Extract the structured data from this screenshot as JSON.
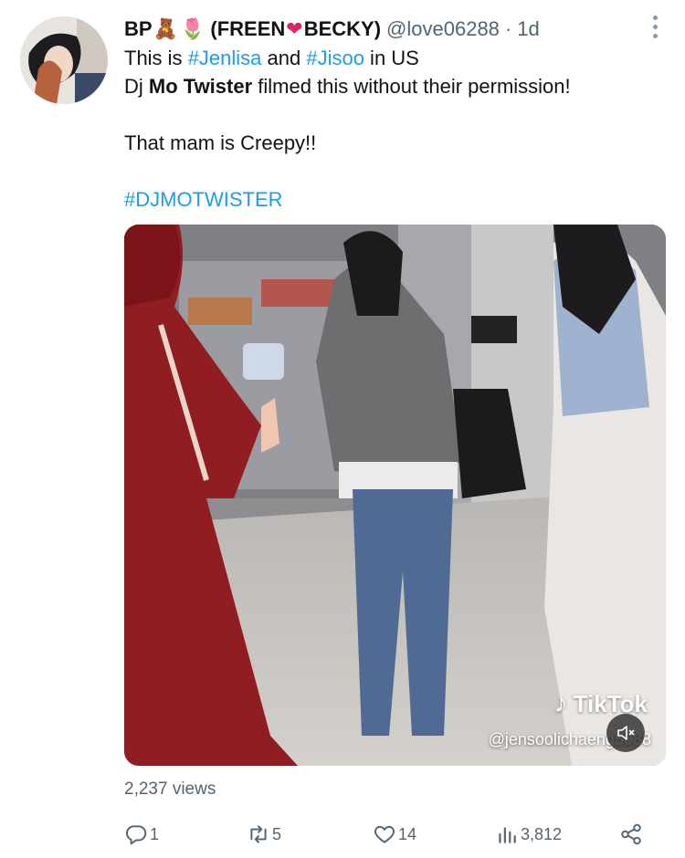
{
  "tweet": {
    "display_name": "BP",
    "name_emoji_1": "🧸",
    "name_emoji_2": "🌷",
    "name_suffix_open": "(FREEN",
    "name_heart": "❤",
    "name_suffix_close": "BECKY)",
    "handle": "@love06288",
    "separator": "·",
    "time": "1d",
    "text": {
      "l1_a": "This is ",
      "l1_tag1": "#Jenlisa",
      "l1_b": " and ",
      "l1_tag2": "#Jisoo",
      "l1_c": " in US",
      "l2_a": "Dj ",
      "l2_bold": "Mo Twister",
      "l2_b": " filmed this without their permission!",
      "l3": "That mam is Creepy!!",
      "l4_tag": "#DJMOTWISTER"
    },
    "media": {
      "watermark_logo": "TikTok",
      "watermark_note": "♪",
      "watermark_user": "@jensoolichaeng5088"
    },
    "views": "2,237 views",
    "actions": {
      "replies": "1",
      "retweets": "5",
      "likes": "14",
      "analytics": "3,812"
    }
  },
  "colors": {
    "link": "#1d9bf0",
    "muted": "#536471",
    "text": "#0f1419",
    "heart": "#e0245e"
  },
  "icons": {
    "more": "more-dots-icon",
    "reply": "reply-icon",
    "retweet": "retweet-icon",
    "like": "heart-icon",
    "analytics": "analytics-icon",
    "share": "share-icon",
    "mute": "mute-icon"
  }
}
